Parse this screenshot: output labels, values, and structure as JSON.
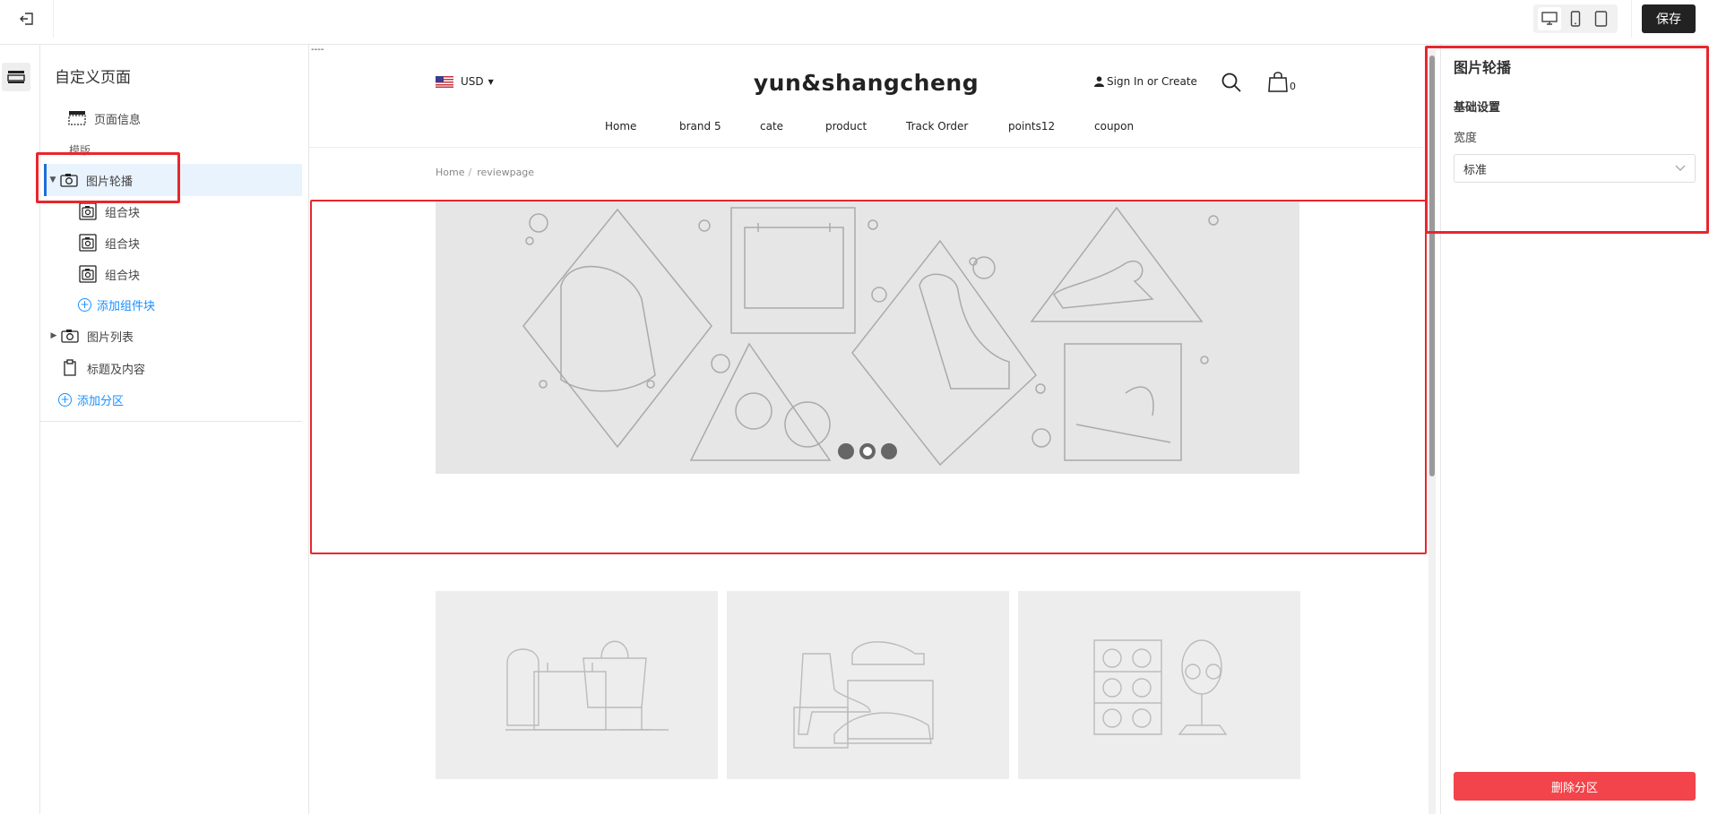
{
  "topbar": {
    "exit_icon": "exit-icon",
    "devices": [
      "desktop-icon",
      "mobile-icon",
      "tablet-icon"
    ],
    "save_label": "保存"
  },
  "rail": {
    "icon": "section-icon"
  },
  "left_panel": {
    "title": "自定义页面",
    "page_info": "页面信息",
    "section_label": "模版",
    "carousel_label": "图片轮播",
    "blocks": [
      "组合块",
      "组合块",
      "组合块"
    ],
    "add_block": "添加组件块",
    "image_list": "图片列表",
    "title_content": "标题及内容",
    "add_section": "添加分区"
  },
  "preview": {
    "dash": "----",
    "currency": "USD",
    "store_title": "yun&shangcheng",
    "signin": "Sign In or Create",
    "cart_count": "0",
    "nav": [
      "Home",
      "brand 5",
      "cate",
      "product",
      "Track Order",
      "points12",
      "coupon"
    ],
    "breadcrumb": {
      "home": "Home",
      "sep": "/",
      "current": "reviewpage"
    },
    "carousel_dots": 3,
    "active_dot": 1
  },
  "right_panel": {
    "title": "图片轮播",
    "subtitle": "基础设置",
    "width_label": "宽度",
    "width_value": "标准",
    "delete_label": "删除分区"
  },
  "colors": {
    "accent": "#1e6fd9",
    "link": "#1890ff",
    "danger": "#f2444a",
    "highlight_box": "#e8262d",
    "save_bg": "#222222"
  }
}
